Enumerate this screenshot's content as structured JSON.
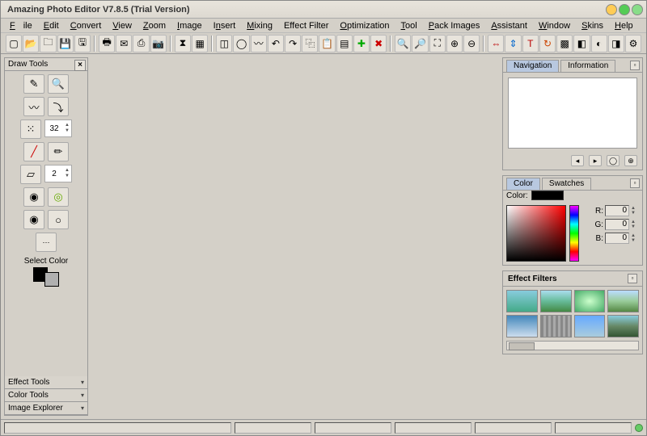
{
  "app": {
    "title": "Amazing Photo Editor V7.8.5 (Trial Version)"
  },
  "menu": {
    "file": "File",
    "edit": "Edit",
    "convert": "Convert",
    "view": "View",
    "zoom": "Zoom",
    "image": "Image",
    "insert": "Insert",
    "mixing": "Mixing",
    "effect_filter": "Effect Filter",
    "optimization": "Optimization",
    "tool": "Tool",
    "pack_images": "Pack Images",
    "assistant": "Assistant",
    "window": "Window",
    "skins": "Skins",
    "help": "Help"
  },
  "left_panel": {
    "draw_tools": "Draw Tools",
    "brush_size": "32",
    "line_size": "2",
    "select_color": "Select Color",
    "effect_tools": "Effect Tools",
    "color_tools": "Color Tools",
    "image_explorer": "Image Explorer"
  },
  "nav_panel": {
    "tab_navigation": "Navigation",
    "tab_information": "Information"
  },
  "color_panel": {
    "tab_color": "Color",
    "tab_swatches": "Swatches",
    "color_label": "Color:",
    "r_label": "R:",
    "r_value": "0",
    "g_label": "G:",
    "g_value": "0",
    "b_label": "B:",
    "b_value": "0"
  },
  "effect_panel": {
    "title": "Effect Filters"
  }
}
